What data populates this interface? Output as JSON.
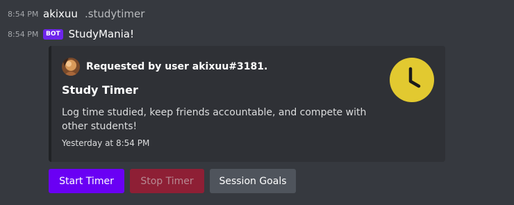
{
  "messages": [
    {
      "time": "8:54 PM",
      "username": "akixuu",
      "text": ".studytimer"
    },
    {
      "time": "8:54 PM",
      "badge": "BOT",
      "username": "StudyMania!"
    }
  ],
  "embed": {
    "author": "Requested by user akixuu#3181.",
    "title": "Study Timer",
    "description": "Log time studied, keep friends accountable, and compete with other students!",
    "footer": "Yesterday at 8:54 PM",
    "thumbnail_icon": "clock-icon",
    "thumbnail_color": "#e2c930"
  },
  "buttons": {
    "start": "Start Timer",
    "stop": "Stop Timer",
    "goals": "Session Goals"
  },
  "colors": {
    "start_button": "#6a00f4",
    "stop_button": "#8e1f35",
    "goals_button": "#4f545c",
    "bot_badge": "#6e25ec"
  }
}
